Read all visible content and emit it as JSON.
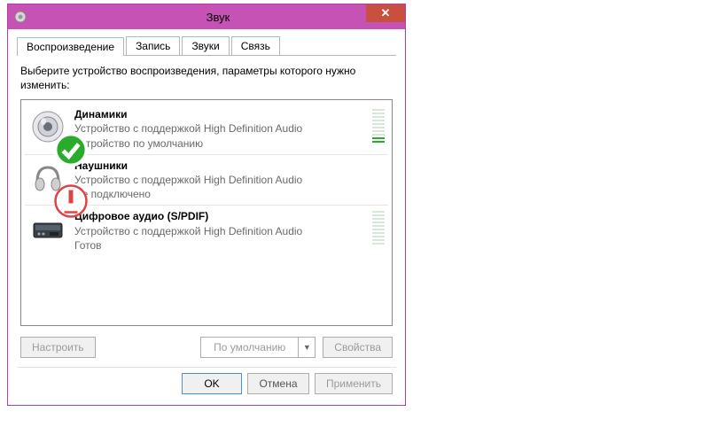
{
  "window": {
    "title": "Звук",
    "close": "✕"
  },
  "tabs": [
    {
      "label": "Воспроизведение"
    },
    {
      "label": "Запись"
    },
    {
      "label": "Звуки"
    },
    {
      "label": "Связь"
    }
  ],
  "instruction": "Выберите устройство воспроизведения, параметры которого нужно изменить:",
  "devices": [
    {
      "name": "Динамики",
      "desc": "Устройство с поддержкой High Definition Audio",
      "state": "Устройство по умолчанию"
    },
    {
      "name": "Наушники",
      "desc": "Устройство с поддержкой High Definition Audio",
      "state": "Не подключено"
    },
    {
      "name": "Цифровое аудио (S/PDIF)",
      "desc": "Устройство с поддержкой High Definition Audio",
      "state": "Готов"
    }
  ],
  "buttons": {
    "configure": "Настроить",
    "set_default": "По умолчанию",
    "properties": "Свойства",
    "ok": "OK",
    "cancel": "Отмена",
    "apply": "Применить"
  }
}
